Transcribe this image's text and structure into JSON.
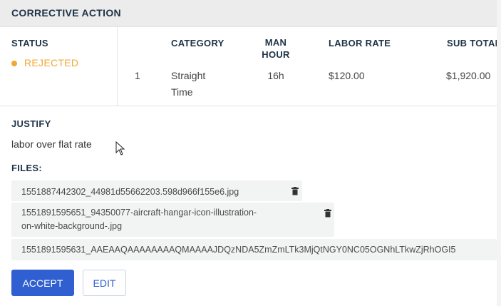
{
  "header": {
    "title": "CORRECTIVE ACTION"
  },
  "status": {
    "label": "STATUS",
    "value": "REJECTED",
    "color": "#f0a833"
  },
  "table": {
    "columns": {
      "category": "CATEGORY",
      "man_hour_1": "MAN",
      "man_hour_2": "HOUR",
      "labor_rate": "LABOR RATE",
      "sub_total": "SUB TOTAL"
    },
    "rows": [
      {
        "index": "1",
        "category_1": "Straight",
        "category_2": "Time",
        "man_hour": "16h",
        "labor_rate": "$120.00",
        "sub_total": "$1,920.00"
      }
    ]
  },
  "justify": {
    "label": "JUSTIFY",
    "text": "labor over flat rate"
  },
  "files": {
    "label": "FILES:",
    "items": [
      {
        "name": "1551887442302_44981d55662203.598d966f155e6.jpg"
      },
      {
        "name_1": "1551891595651_94350077-aircraft-hangar-icon-illustration-",
        "name_2": "on-white-background-.jpg"
      },
      {
        "name": "1551891595631_AAEAAQAAAAAAAAQMAAAAJDQzNDA5ZmZmLTk3MjQtNGY0NC05OGNhLTkwZjRhOGI5"
      }
    ]
  },
  "actions": {
    "accept": "ACCEPT",
    "edit": "EDIT"
  },
  "colors": {
    "primary": "#2f5fd1",
    "warning": "#f0a833",
    "header_bg": "#ececec"
  }
}
